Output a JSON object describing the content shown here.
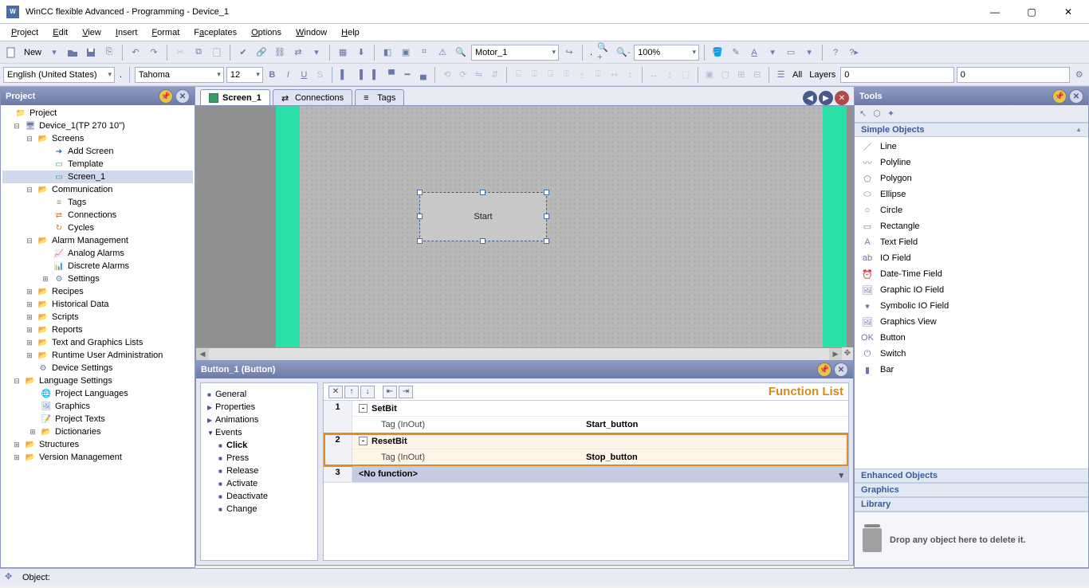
{
  "app": {
    "title": "WinCC flexible Advanced - Programming - Device_1"
  },
  "menu": [
    "Project",
    "Edit",
    "View",
    "Insert",
    "Format",
    "Faceplates",
    "Options",
    "Window",
    "Help"
  ],
  "toolbar1": {
    "new": "New",
    "motor_combo": "Motor_1",
    "zoom": "100%"
  },
  "toolbar2": {
    "lang": "English (United States)",
    "font": "Tahoma",
    "size": "12",
    "layers_lbl": "Layers",
    "all_lbl": "All",
    "num1": "0",
    "num2": "0"
  },
  "panels": {
    "project": "Project",
    "tools": "Tools",
    "props": "Button_1 (Button)"
  },
  "tree": {
    "root": "Project",
    "device": "Device_1(TP 270 10\")",
    "screens": "Screens",
    "add_screen": "Add Screen",
    "template": "Template",
    "screen1": "Screen_1",
    "communication": "Communication",
    "tags": "Tags",
    "connections": "Connections",
    "cycles": "Cycles",
    "alarm_mgmt": "Alarm Management",
    "analog_alarms": "Analog Alarms",
    "discrete_alarms": "Discrete Alarms",
    "settings_node": "Settings",
    "recipes": "Recipes",
    "historical": "Historical Data",
    "scripts": "Scripts",
    "reports": "Reports",
    "textlists": "Text and Graphics Lists",
    "runtime_ua": "Runtime User Administration",
    "device_settings": "Device Settings",
    "lang_settings": "Language Settings",
    "proj_langs": "Project Languages",
    "graphics": "Graphics",
    "proj_texts": "Project Texts",
    "dictionaries": "Dictionaries",
    "structures": "Structures",
    "version_mgmt": "Version Management"
  },
  "doctabs": {
    "screen1": "Screen_1",
    "connections": "Connections",
    "tags": "Tags"
  },
  "canvas": {
    "button_text": "Start"
  },
  "propnav": {
    "general": "General",
    "properties": "Properties",
    "animations": "Animations",
    "events": "Events",
    "click": "Click",
    "press": "Press",
    "release": "Release",
    "activate": "Activate",
    "deactivate": "Deactivate",
    "change": "Change"
  },
  "funclist": {
    "title": "Function List",
    "rows": [
      {
        "n": "1",
        "fn": "SetBit",
        "param": "Tag (InOut)",
        "val": "Start_button"
      },
      {
        "n": "2",
        "fn": "ResetBit",
        "param": "Tag (InOut)",
        "val": "Stop_button"
      }
    ],
    "row3_n": "3",
    "nofunc": "<No function>"
  },
  "tools": {
    "section_simple": "Simple Objects",
    "items": [
      "Line",
      "Polyline",
      "Polygon",
      "Ellipse",
      "Circle",
      "Rectangle",
      "Text Field",
      "IO Field",
      "Date-Time Field",
      "Graphic IO Field",
      "Symbolic IO Field",
      "Graphics View",
      "Button",
      "Switch",
      "Bar"
    ],
    "section_enhanced": "Enhanced Objects",
    "section_graphics": "Graphics",
    "section_library": "Library",
    "drop_hint": "Drop any object here to delete it."
  },
  "statusbar": {
    "label": "Object:"
  }
}
